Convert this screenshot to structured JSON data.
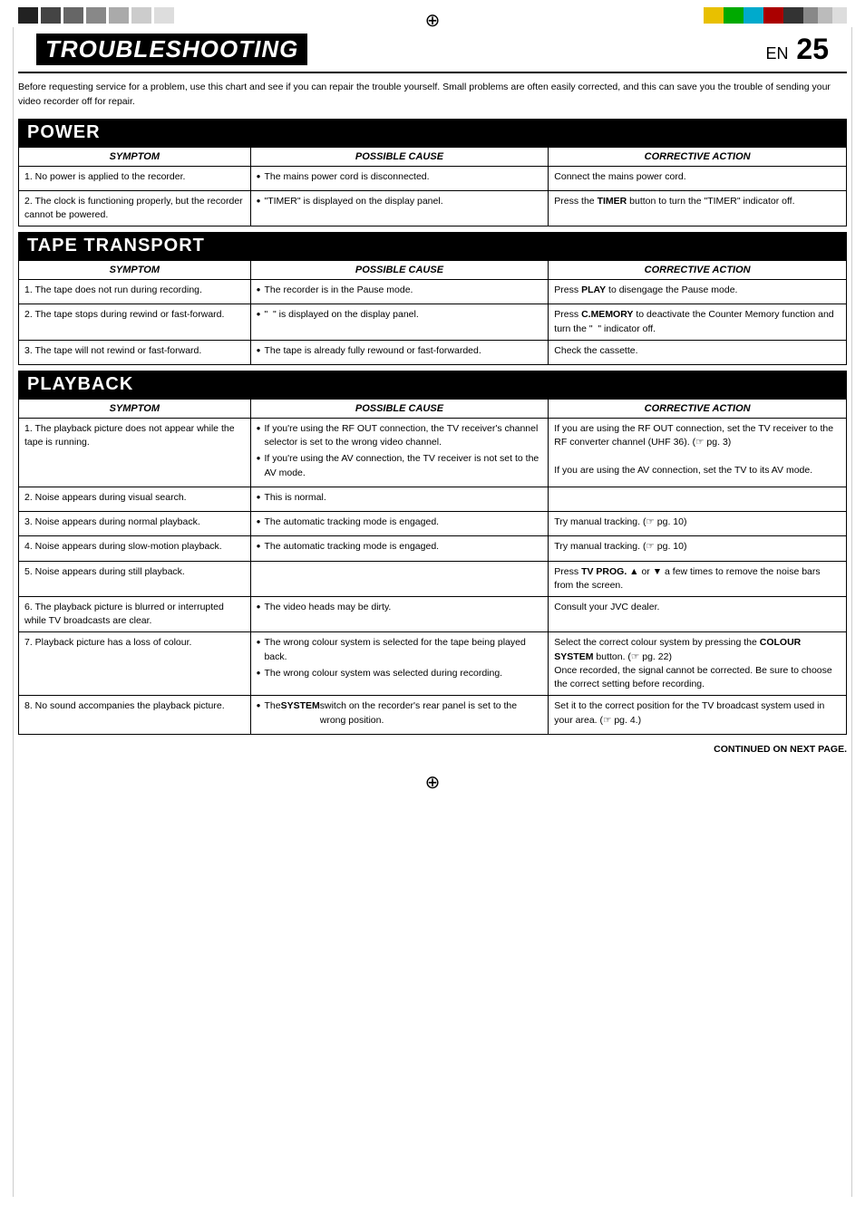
{
  "header": {
    "title": "TROUBLESHOOTING",
    "page": "EN 25",
    "crosshair": "⊕"
  },
  "intro": "Before requesting service for a problem, use this chart and see if you can repair the trouble yourself. Small problems are often easily corrected, and this can save you the trouble of sending your video recorder off for repair.",
  "continued": "CONTINUED ON NEXT PAGE.",
  "sections": [
    {
      "id": "power",
      "title": "POWER",
      "columns": [
        "SYMPTOM",
        "POSSIBLE CAUSE",
        "CORRECTIVE ACTION"
      ],
      "rows": [
        {
          "symptom": "1. No power is applied to the recorder.",
          "cause": [
            "The mains power cord is disconnected."
          ],
          "action": "Connect the mains power cord."
        },
        {
          "symptom": "2. The clock is functioning properly, but the recorder cannot be powered.",
          "cause": [
            "\"TIMER\" is displayed on the display panel."
          ],
          "action": "Press the TIMER button to turn the \"TIMER\" indicator off."
        }
      ]
    },
    {
      "id": "tape_transport",
      "title": "TAPE TRANSPORT",
      "columns": [
        "SYMPTOM",
        "POSSIBLE CAUSE",
        "CORRECTIVE ACTION"
      ],
      "rows": [
        {
          "symptom": "1. The tape does not run during recording.",
          "cause": [
            "The recorder is in the Pause mode."
          ],
          "action": "Press PLAY to disengage the Pause mode."
        },
        {
          "symptom": "2. The tape stops during rewind or fast-forward.",
          "cause": [
            "\"  \" is displayed on the display panel."
          ],
          "action": "Press C.MEMORY to deactivate the Counter Memory function and turn the \"  \" indicator off."
        },
        {
          "symptom": "3. The tape will not rewind or fast-forward.",
          "cause": [
            "The tape is already fully rewound or fast-forwarded."
          ],
          "action": "Check the cassette."
        }
      ]
    },
    {
      "id": "playback",
      "title": "PLAYBACK",
      "columns": [
        "SYMPTOM",
        "POSSIBLE CAUSE",
        "CORRECTIVE ACTION"
      ],
      "rows": [
        {
          "symptom": "1. The playback picture does not appear while the tape is running.",
          "cause": [
            "If you're using the RF OUT connection, the TV receiver's channel selector is set to the wrong video channel.",
            "If you're using the AV connection, the TV receiver is not set to the AV mode."
          ],
          "action": "If you are using the RF OUT connection, set the TV receiver to the RF converter channel (UHF 36). (☞ pg. 3)\n\nIf you are using the AV connection, set the TV to its AV mode."
        },
        {
          "symptom": "2. Noise appears during visual search.",
          "cause": [
            "This is normal."
          ],
          "action": ""
        },
        {
          "symptom": "3. Noise appears during normal playback.",
          "cause": [
            "The automatic tracking mode is engaged."
          ],
          "action": "Try manual tracking. (☞ pg. 10)"
        },
        {
          "symptom": "4. Noise appears during slow-motion playback.",
          "cause": [
            "The automatic tracking mode is engaged."
          ],
          "action": "Try manual tracking. (☞ pg. 10)"
        },
        {
          "symptom": "5. Noise appears during still playback.",
          "cause": [],
          "action": "Press TV PROG. ▲ or ▼ a few times to remove the noise bars from the screen."
        },
        {
          "symptom": "6. The playback picture is blurred or interrupted while TV broadcasts are clear.",
          "cause": [
            "The video heads may be dirty."
          ],
          "action": "Consult your JVC dealer."
        },
        {
          "symptom": "7. Playback picture has a loss of colour.",
          "cause": [
            "The wrong colour system is selected for the tape being played back.",
            "The wrong colour system was selected during recording."
          ],
          "action": "Select the correct colour system by pressing the COLOUR SYSTEM button. (☞ pg. 22)\nOnce recorded, the signal cannot be corrected. Be sure to choose the correct setting before recording."
        },
        {
          "symptom": "8. No sound accompanies the playback picture.",
          "cause": [
            "The SYSTEM switch on the recorder's rear panel is set to the wrong position."
          ],
          "action": "Set it to the correct position for the TV broadcast system used in your area. (☞ pg. 4.)"
        }
      ]
    }
  ]
}
